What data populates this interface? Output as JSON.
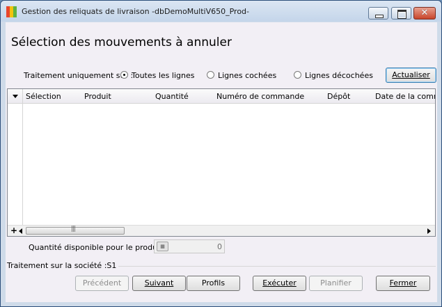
{
  "window": {
    "title": "Gestion des reliquats de livraison -dbDemoMultiV650_Prod-",
    "close_glyph": "✕"
  },
  "header": {
    "title": "Sélection des mouvements à annuler"
  },
  "filter": {
    "label": "Traitement uniquement sur :",
    "options": [
      {
        "label": "Toutes les lignes",
        "selected": true
      },
      {
        "label": "Lignes cochées",
        "selected": false
      },
      {
        "label": "Lignes décochées",
        "selected": false
      }
    ],
    "refresh_label": "Actualiser"
  },
  "grid": {
    "columns": [
      "Sélection",
      "Produit",
      "Quantité",
      "Numéro de commande",
      "Dépôt",
      "Date de la comma"
    ],
    "rows": [],
    "add_symbol": "+"
  },
  "quantity": {
    "label": "Quantité disponible pour le produit :",
    "calc_icon": "calculator-icon",
    "value": "0"
  },
  "society": {
    "text": "Traitement sur la société :S1"
  },
  "footer": {
    "previous": {
      "label": "Précédent",
      "enabled": false
    },
    "next": {
      "label": "Suivant",
      "enabled": true
    },
    "profiles": {
      "label": "Profils",
      "enabled": true
    },
    "execute": {
      "label": "Exécuter",
      "enabled": true
    },
    "schedule": {
      "label": "Planifier",
      "enabled": false
    },
    "close": {
      "label": "Fermer",
      "enabled": true
    }
  },
  "colors": {
    "titlebar": "#c4d5ea",
    "client_bg": "#f2eff5",
    "close_button": "#c8452b"
  }
}
